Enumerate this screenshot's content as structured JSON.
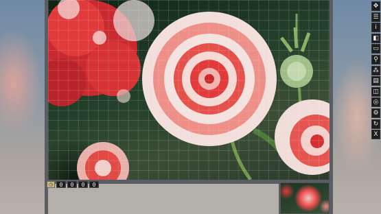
{
  "timer": {
    "digits": [
      "0",
      "0",
      "0",
      "0"
    ],
    "clock_glyph": "◷"
  },
  "toolbar": {
    "buttons": [
      {
        "name": "move-pieces-icon",
        "glyph": "✥"
      },
      {
        "name": "menu-icon",
        "glyph": "☰"
      },
      {
        "name": "info-icon",
        "glyph": "i"
      },
      {
        "name": "edges-icon",
        "glyph": "◧"
      },
      {
        "name": "ghost-image-icon",
        "glyph": "▭"
      },
      {
        "name": "zoom-icon",
        "glyph": "⚲"
      },
      {
        "name": "scatter-icon",
        "glyph": "⁂"
      },
      {
        "name": "save-icon",
        "glyph": "▤"
      },
      {
        "name": "screenshot-icon",
        "glyph": "◫"
      },
      {
        "name": "background-icon",
        "glyph": "◎"
      },
      {
        "name": "settings-icon",
        "glyph": "⚙"
      },
      {
        "name": "restart-icon",
        "glyph": "↻"
      },
      {
        "name": "close-icon",
        "glyph": "X"
      }
    ]
  },
  "colors": {
    "flower_red": "#e23a3a",
    "flower_white": "#f4e7e6",
    "stem_green": "#6f9a4a",
    "toolbar_bg": "#1e1e1e"
  }
}
